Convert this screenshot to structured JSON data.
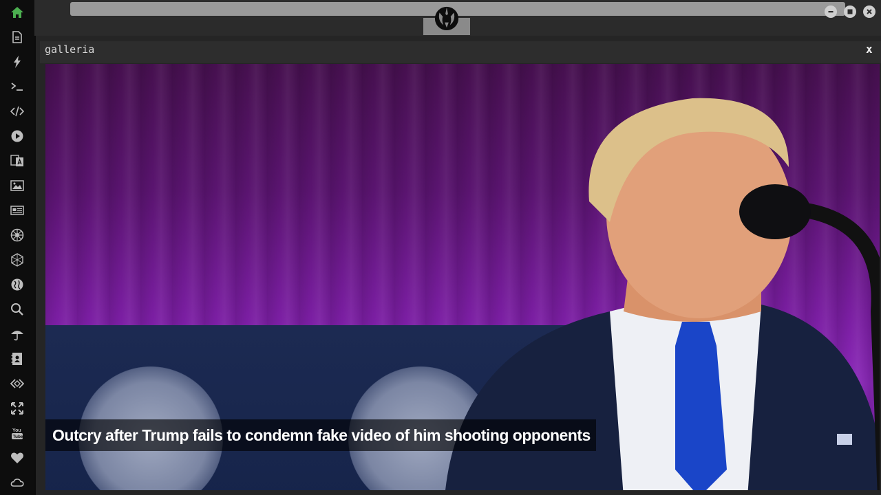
{
  "window": {
    "title": "galleria",
    "close_label": "x"
  },
  "caption": {
    "text": "Outcry after Trump fails to condemn fake video of him shooting opponents"
  },
  "colors": {
    "rail_bg": "#0d0d0d",
    "home_icon": "#4caf50",
    "rail_icon": "#bdbdbd",
    "topbar_bg": "#2b2b2b",
    "frame_bg": "#252525",
    "stage_purple": "#7b1ea3"
  },
  "rail": {
    "items": [
      {
        "icon": "home-icon"
      },
      {
        "icon": "document-icon"
      },
      {
        "icon": "lightning-icon"
      },
      {
        "icon": "terminal-icon"
      },
      {
        "icon": "code-icon"
      },
      {
        "icon": "play-icon"
      },
      {
        "icon": "translate-icon"
      },
      {
        "icon": "image-icon"
      },
      {
        "icon": "newspaper-icon"
      },
      {
        "icon": "galactic-empire-icon"
      },
      {
        "icon": "hexagon-icon"
      },
      {
        "icon": "globe-icon"
      },
      {
        "icon": "search-icon"
      },
      {
        "icon": "umbrella-icon"
      },
      {
        "icon": "contacts-icon"
      },
      {
        "icon": "diamond-code-icon"
      },
      {
        "icon": "expand-icon"
      },
      {
        "icon": "youtube-icon"
      },
      {
        "icon": "heart-icon"
      },
      {
        "icon": "cloud-icon"
      }
    ]
  },
  "topbar": {
    "logo_icon": "rebel-alliance-icon",
    "window_buttons": [
      "minimize-icon",
      "maximize-icon",
      "close-icon"
    ]
  }
}
